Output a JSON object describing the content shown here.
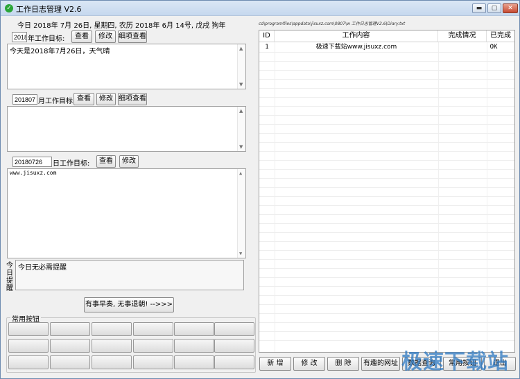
{
  "window": {
    "title": "工作日志管理 V2.6",
    "icon": "check-icon",
    "controls": {
      "minimize": "▬",
      "maximize": "▢",
      "close": "✕"
    }
  },
  "date_line": "今日 2018年 7月 26日, 星期四, 农历 2018年 6月 14号, 戊戌 狗年",
  "file_path": "cd\\programfiles\\appdata\\jisuxz.com\\0807\\w 工作日志管理V2.6\\Diary.txt",
  "year_goal": {
    "value": "2018",
    "label": "年工作目标:",
    "view_btn": "查看",
    "edit_btn": "修改",
    "detail_btn": "细项查看",
    "content": "今天是2018年7月26日，天气晴"
  },
  "month_goal": {
    "value": "201807",
    "label": "月工作目标:",
    "view_btn": "查看",
    "edit_btn": "修改",
    "detail_btn": "细项查看",
    "content": ""
  },
  "day_goal": {
    "value": "20180726",
    "label": "日工作目标:",
    "view_btn": "查看",
    "edit_btn": "修改",
    "content": "www.jisuxz.com"
  },
  "reminder": {
    "label": "今日提醒",
    "content": "今日无必需提醒"
  },
  "motto_button": "有事早奏, 无事退朝! -->>>",
  "common_buttons_label": "常用按钮",
  "table": {
    "headers": [
      "ID",
      "工作内容",
      "完成情况",
      "已完成"
    ],
    "rows": [
      {
        "id": "1",
        "content": "极速下载站www.jisuxz.com",
        "status": "",
        "done": "OK"
      }
    ]
  },
  "bottom_buttons": {
    "add": "新 增",
    "edit": "修 改",
    "delete": "删 除",
    "fun_sites": "有趣的网址",
    "data_btn": "数据查询",
    "common_btn": "常用按钮",
    "exit": "退出"
  },
  "watermark": "极速下载站"
}
